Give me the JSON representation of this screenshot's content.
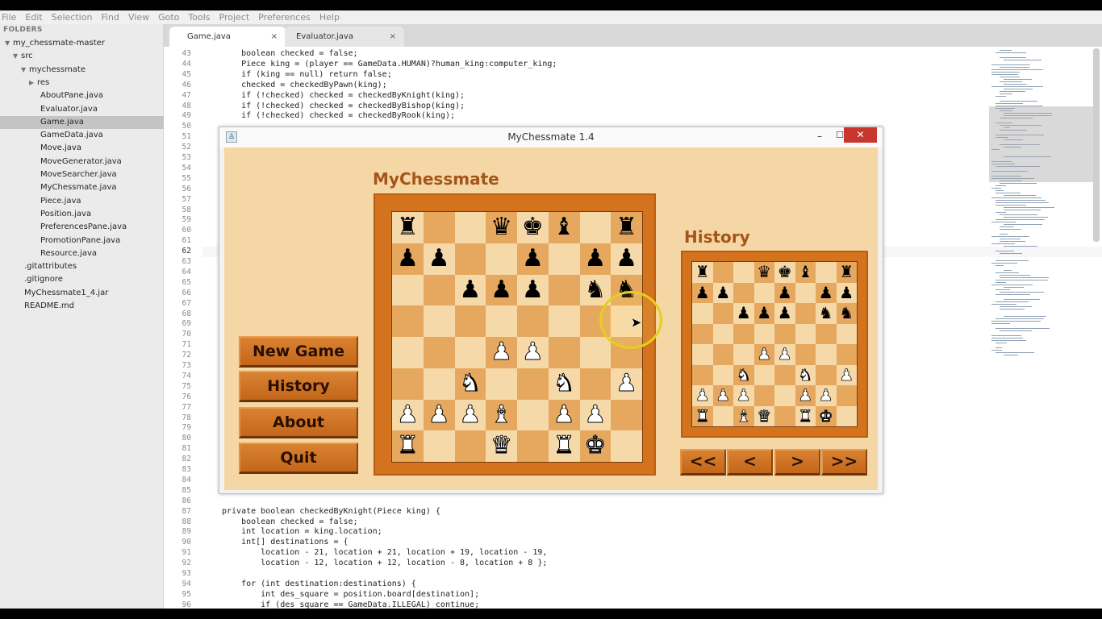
{
  "menubar": [
    "File",
    "Edit",
    "Selection",
    "Find",
    "View",
    "Goto",
    "Tools",
    "Project",
    "Preferences",
    "Help"
  ],
  "sidebar": {
    "header": "FOLDERS",
    "items": [
      {
        "label": "my_chessmate-master",
        "depth": 0,
        "arrow": "open"
      },
      {
        "label": "src",
        "depth": 1,
        "arrow": "open"
      },
      {
        "label": "mychessmate",
        "depth": 2,
        "arrow": "open"
      },
      {
        "label": "res",
        "depth": 3,
        "arrow": "closed"
      },
      {
        "label": "AboutPane.java",
        "depth": 4
      },
      {
        "label": "Evaluator.java",
        "depth": 4
      },
      {
        "label": "Game.java",
        "depth": 4,
        "selected": true
      },
      {
        "label": "GameData.java",
        "depth": 4
      },
      {
        "label": "Move.java",
        "depth": 4
      },
      {
        "label": "MoveGenerator.java",
        "depth": 4
      },
      {
        "label": "MoveSearcher.java",
        "depth": 4
      },
      {
        "label": "MyChessmate.java",
        "depth": 4
      },
      {
        "label": "Piece.java",
        "depth": 4
      },
      {
        "label": "Position.java",
        "depth": 4
      },
      {
        "label": "PreferencesPane.java",
        "depth": 4
      },
      {
        "label": "PromotionPane.java",
        "depth": 4
      },
      {
        "label": "Resource.java",
        "depth": 4
      },
      {
        "label": ".gitattributes",
        "depth": 2
      },
      {
        "label": ".gitignore",
        "depth": 2
      },
      {
        "label": "MyChessmate1_4.jar",
        "depth": 2
      },
      {
        "label": "README.md",
        "depth": 2
      }
    ]
  },
  "tabs": [
    {
      "label": "Game.java",
      "active": true,
      "close": "×"
    },
    {
      "label": "Evaluator.java",
      "active": false,
      "close": "×"
    }
  ],
  "editor": {
    "current_line": 62,
    "lines": [
      {
        "n": 43,
        "t": "    boolean checked = false;"
      },
      {
        "n": 44,
        "t": "    Piece king = (player == GameData.HUMAN)?human_king:computer_king;"
      },
      {
        "n": 45,
        "t": "    if (king == null) return false;"
      },
      {
        "n": 46,
        "t": "    checked = checkedByPawn(king);"
      },
      {
        "n": 47,
        "t": "    if (!checked) checked = checkedByKnight(king);"
      },
      {
        "n": 48,
        "t": "    if (!checked) checked = checkedByBishop(king);"
      },
      {
        "n": 49,
        "t": "    if (!checked) checked = checkedByRook(king);"
      },
      {
        "n": 50,
        "t": ""
      },
      {
        "n": 51,
        "t": ""
      },
      {
        "n": 52,
        "t": ""
      },
      {
        "n": 53,
        "t": ""
      },
      {
        "n": 54,
        "t": ""
      },
      {
        "n": 55,
        "t": ""
      },
      {
        "n": 56,
        "t": ""
      },
      {
        "n": 57,
        "t": ""
      },
      {
        "n": 58,
        "t": ""
      },
      {
        "n": 59,
        "t": ""
      },
      {
        "n": 60,
        "t": ""
      },
      {
        "n": 61,
        "t": ""
      },
      {
        "n": 62,
        "t": ""
      },
      {
        "n": 63,
        "t": ""
      },
      {
        "n": 64,
        "t": ""
      },
      {
        "n": 65,
        "t": ""
      },
      {
        "n": 66,
        "t": ""
      },
      {
        "n": 67,
        "t": ""
      },
      {
        "n": 68,
        "t": ""
      },
      {
        "n": 69,
        "t": ""
      },
      {
        "n": 70,
        "t": ""
      },
      {
        "n": 71,
        "t": ""
      },
      {
        "n": 72,
        "t": ""
      },
      {
        "n": 73,
        "t": ""
      },
      {
        "n": 74,
        "t": ""
      },
      {
        "n": 75,
        "t": ""
      },
      {
        "n": 76,
        "t": ""
      },
      {
        "n": 77,
        "t": ""
      },
      {
        "n": 78,
        "t": ""
      },
      {
        "n": 79,
        "t": ""
      },
      {
        "n": 80,
        "t": ""
      },
      {
        "n": 81,
        "t": ""
      },
      {
        "n": 82,
        "t": ""
      },
      {
        "n": 83,
        "t": ""
      },
      {
        "n": 84,
        "t": ""
      },
      {
        "n": 85,
        "t": ""
      },
      {
        "n": 86,
        "t": ""
      },
      {
        "n": 87,
        "t": "private boolean checkedByKnight(Piece king) {"
      },
      {
        "n": 88,
        "t": "    boolean checked = false;"
      },
      {
        "n": 89,
        "t": "    int location = king.location;"
      },
      {
        "n": 90,
        "t": "    int[] destinations = {"
      },
      {
        "n": 91,
        "t": "        location - 21, location + 21, location + 19, location - 19,"
      },
      {
        "n": 92,
        "t": "        location - 12, location + 12, location - 8, location + 8 };"
      },
      {
        "n": 93,
        "t": ""
      },
      {
        "n": 94,
        "t": "    for (int destination:destinations) {"
      },
      {
        "n": 95,
        "t": "        int des_square = position.board[destination];"
      },
      {
        "n": 96,
        "t": "        if (des_square == GameData.ILLEGAL) continue;"
      }
    ]
  },
  "chess_window": {
    "title": "MyChessmate 1.4",
    "icon": "♙",
    "minimize": "–",
    "maximize": "☐",
    "close": "✕",
    "app_title": "MyChessmate",
    "history_title": "History",
    "buttons": [
      "New Game",
      "History",
      "About",
      "Quit"
    ],
    "nav_buttons": [
      "<<",
      "<",
      ">",
      ">>"
    ],
    "board": [
      "r..qkb.r",
      "pp..p.pp",
      "..ppp.nn",
      "........",
      "...PP...",
      "..N..N.P",
      "PPPB.PP.",
      "R..Q.RK."
    ],
    "history_board": [
      "r..qkb.r",
      "pp..p.pp",
      "..ppp.nn",
      "........",
      "...PP...",
      "..N..N.P",
      "PPP..PP.",
      "R.BQ.RK."
    ]
  },
  "glyphs": {
    "k": "♚",
    "q": "♛",
    "r": "♜",
    "b": "♝",
    "n": "♞",
    "p": "♟",
    "K": "♚",
    "Q": "♛",
    "R": "♜",
    "B": "♝",
    "N": "♞",
    "P": "♟"
  },
  "cursor": "➤"
}
